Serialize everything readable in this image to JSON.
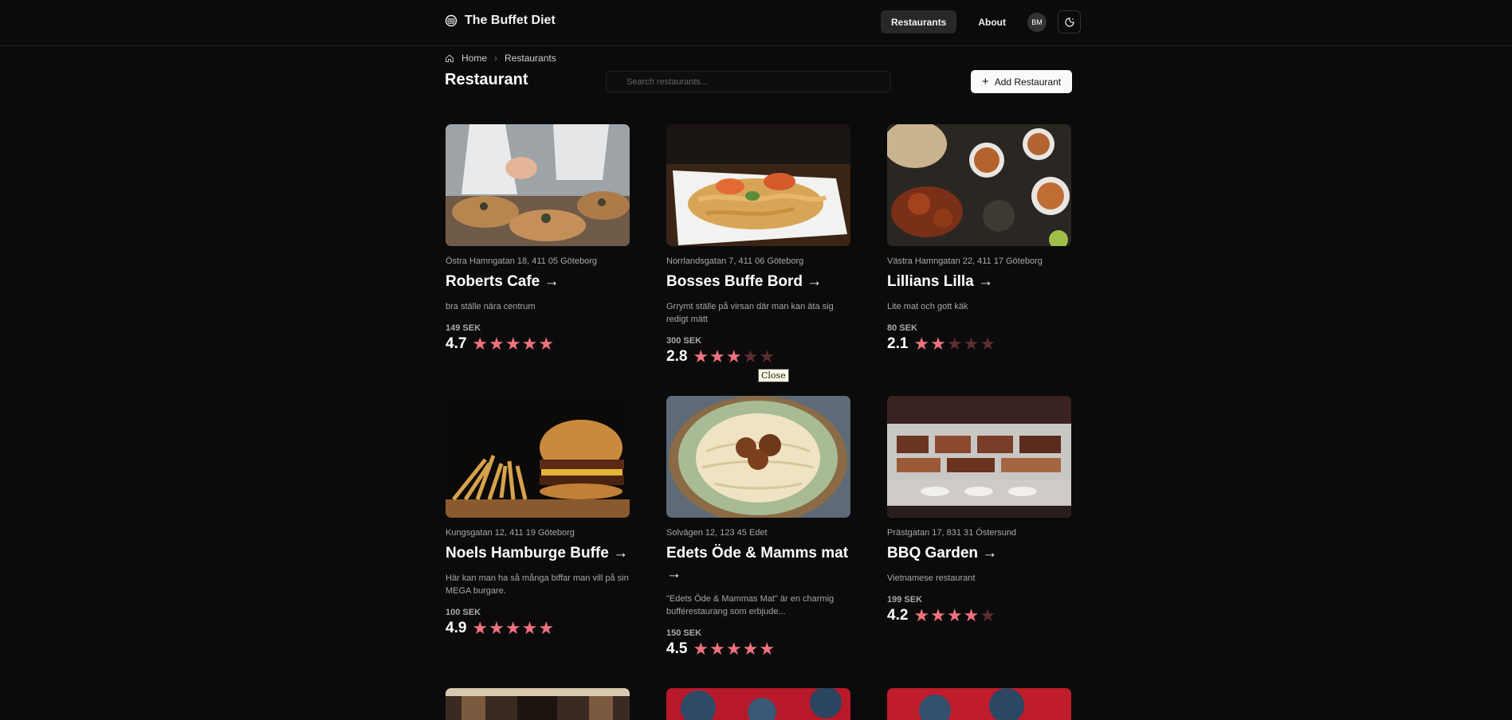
{
  "header": {
    "brand": "The Buffet Diet",
    "nav_restaurants": "Restaurants",
    "nav_about": "About",
    "avatar_initials": "BM"
  },
  "breadcrumb": {
    "home": "Home",
    "current": "Restaurants"
  },
  "page_title": "Restaurant",
  "search": {
    "placeholder": "Search restaurants..."
  },
  "add_button": "Add Restaurant",
  "tooltip": "Close",
  "colors": {
    "accent_star": "#f0727f",
    "background": "#0b0b0b"
  },
  "restaurants": [
    {
      "address": "Östra Hamngatan 18, 411 05 Göteborg",
      "name": "Roberts Cafe →",
      "description": "bra ställe nära centrum",
      "price": "149 SEK",
      "rating": "4.7",
      "stars": 5
    },
    {
      "address": "Norrlandsgatan 7, 411 06 Göteborg",
      "name": "Bosses Buffe Bord →",
      "description": "Grrymt ställe på virsan där man kan äta sig redigt mätt",
      "price": "300 SEK",
      "rating": "2.8",
      "stars": 3
    },
    {
      "address": "Västra Hamngatan 22, 411 17 Göteborg",
      "name": "Lillians Lilla →",
      "description": "Lite mat och gott käk",
      "price": "80 SEK",
      "rating": "2.1",
      "stars": 2
    },
    {
      "address": "Kungsgatan 12, 411 19 Göteborg",
      "name": "Noels Hamburge Buffe →",
      "description": "Här kan man ha så många biffar man vill på sin MEGA burgare.",
      "price": "100 SEK",
      "rating": "4.9",
      "stars": 5
    },
    {
      "address": "Solvägen 12, 123 45 Edet",
      "name": "Edets Öde & Mamms mat →",
      "description": "\"Edets Öde & Mammas Mat\" är en charmig bufférestaurang som erbjude...",
      "price": "150 SEK",
      "rating": "4.5",
      "stars": 5
    },
    {
      "address": "Prästgatan 17, 831 31 Östersund",
      "name": "BBQ Garden →",
      "description": "Vietnamese restaurant",
      "price": "199 SEK",
      "rating": "4.2",
      "stars": 4
    }
  ]
}
